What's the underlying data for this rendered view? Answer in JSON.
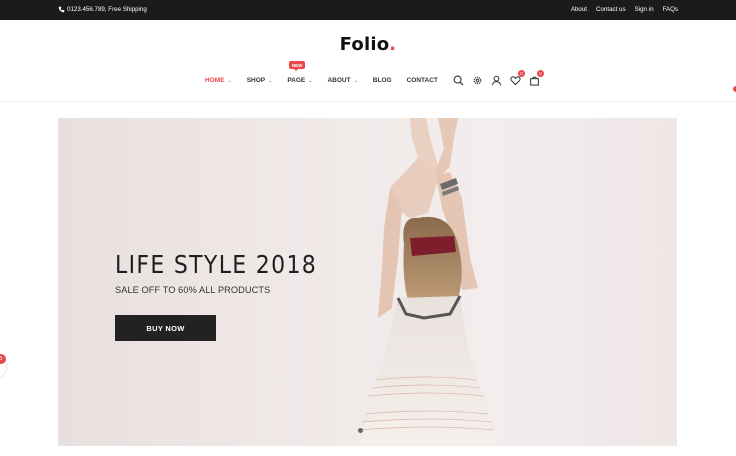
{
  "topbar": {
    "contact_text": "0123.456.789, Free Shipping",
    "links": [
      "About",
      "Contact us",
      "Sign in",
      "FAQs"
    ]
  },
  "header": {
    "logo_text": "Folio",
    "logo_dot": ".",
    "nav": [
      {
        "label": "HOME",
        "has_dropdown": true,
        "active": true
      },
      {
        "label": "SHOP",
        "has_dropdown": true
      },
      {
        "label": "PAGE",
        "has_dropdown": true,
        "badge": "NEW"
      },
      {
        "label": "ABOUT",
        "has_dropdown": true
      },
      {
        "label": "BLOG",
        "has_dropdown": false
      },
      {
        "label": "CONTACT",
        "has_dropdown": false
      }
    ],
    "icons": [
      "search-icon",
      "gear-icon",
      "user-icon",
      "heart-icon",
      "cart-icon"
    ],
    "wishlist_count": "0",
    "cart_count": "0"
  },
  "hero": {
    "title": "LIFE STYLE 2018",
    "subtitle": "SALE OFF TO 60% ALL PRODUCTS",
    "button_label": "BUY NOW"
  },
  "side_widget": {
    "badge_count": "0"
  },
  "colors": {
    "accent": "#e8474c",
    "topbar_bg": "#1b1b1b",
    "button_bg": "#222222"
  }
}
